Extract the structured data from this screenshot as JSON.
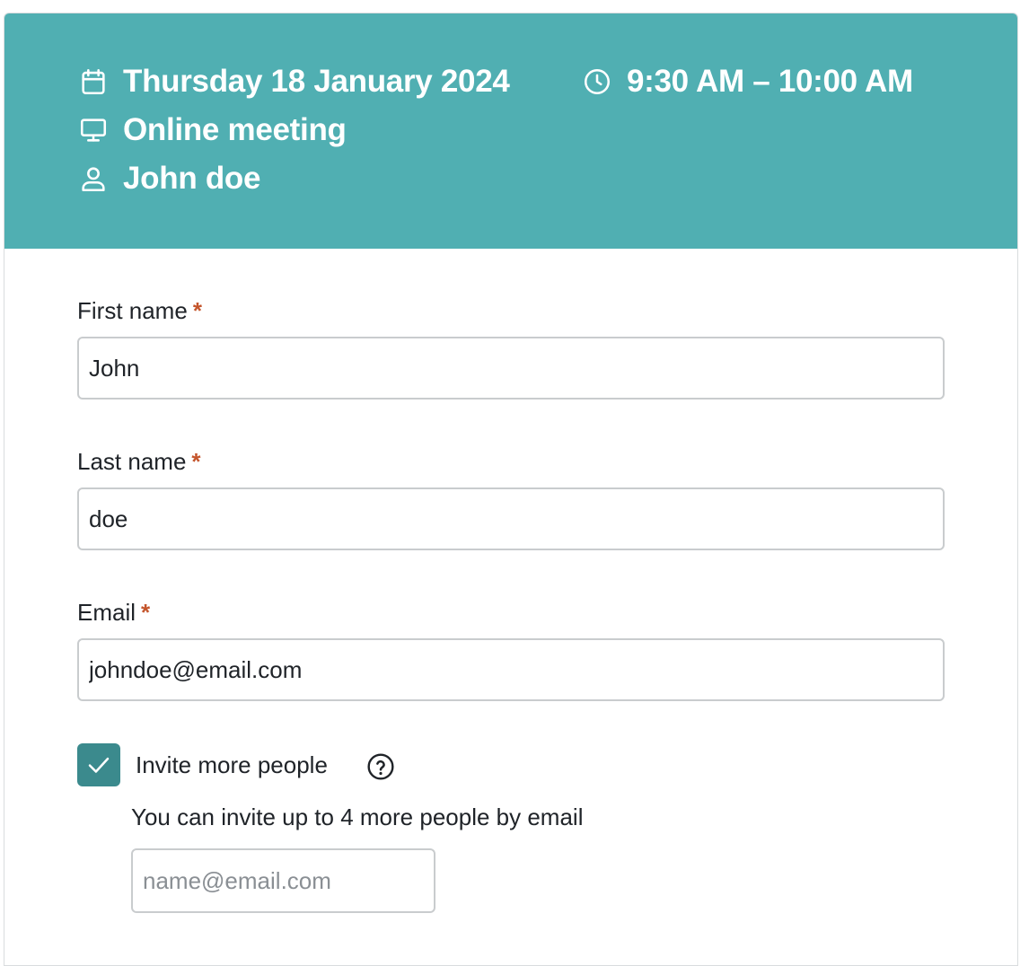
{
  "header": {
    "date": "Thursday 18 January 2024",
    "time": "9:30 AM – 10:00 AM",
    "location": "Online meeting",
    "person": "John doe",
    "icons": {
      "date": "calendar-icon",
      "time": "clock-icon",
      "location": "monitor-icon",
      "person": "user-icon"
    },
    "background_color": "#50afb2"
  },
  "form": {
    "required_marker": "*",
    "first_name": {
      "label": "First name",
      "value": "John"
    },
    "last_name": {
      "label": "Last name",
      "value": "doe"
    },
    "email": {
      "label": "Email",
      "value": "johndoe@email.com"
    },
    "invite": {
      "label": "Invite more people",
      "checked": true,
      "hint": "You can invite up to 4 more people by email",
      "placeholder": "name@email.com",
      "help_icon": "question-circle-icon"
    }
  },
  "colors": {
    "accent": "#3b8a8d",
    "required": "#c4552c"
  }
}
